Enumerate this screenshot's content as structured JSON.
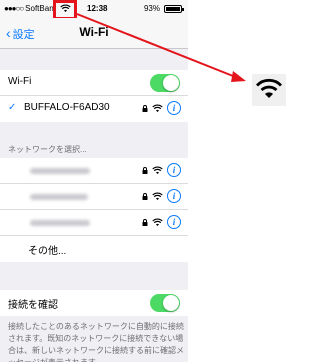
{
  "status_bar": {
    "carrier": "SoftBan",
    "time": "12:38",
    "battery": "93%",
    "wifi_icon": "wifi-icon",
    "battery_icon": "battery-icon",
    "battery_level": 0.93
  },
  "nav": {
    "back_label": "設定",
    "title": "Wi-Fi"
  },
  "wifi_row": {
    "label": "Wi-Fi",
    "enabled": true
  },
  "connected": {
    "name": "BUFFALO-F6AD30"
  },
  "network_section": {
    "header": "ネットワークを選択..."
  },
  "networks": [
    {
      "secured": true
    },
    {
      "secured": true
    },
    {
      "secured": true
    }
  ],
  "other_label": "その他...",
  "ask_join": {
    "label": "接続を確認",
    "enabled": true
  },
  "footer": "接続したことのあるネットワークに自動的に接続されます。既知のネットワークに接続できない場合は、新しいネットワークに接続する前に確認メッセージが表示されます。",
  "colors": {
    "accent": "#0a7aff",
    "toggle_on": "#4cd964",
    "highlight": "#e3141b"
  }
}
